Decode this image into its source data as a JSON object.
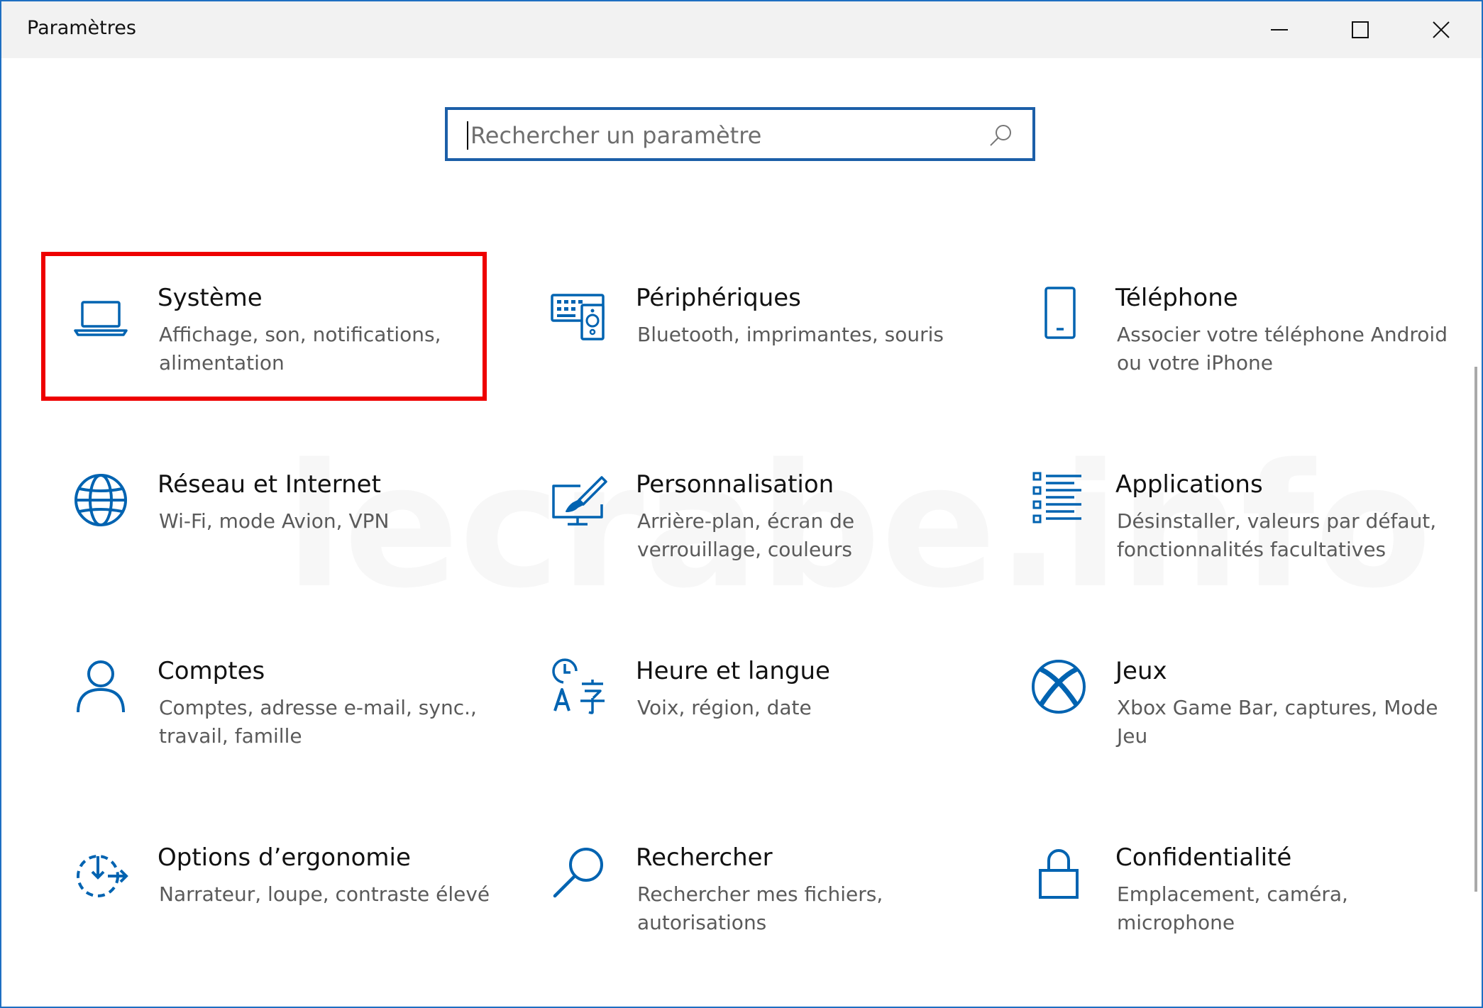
{
  "window": {
    "title": "Paramètres",
    "accent_color": "#0063b1",
    "controls": {
      "minimize_icon": "minimize-icon",
      "maximize_icon": "maximize-icon",
      "close_icon": "close-icon"
    }
  },
  "search": {
    "placeholder": "Rechercher un paramètre",
    "value": "",
    "icon": "search-icon"
  },
  "watermark": "lecrabe.info",
  "categories": [
    {
      "id": "systeme",
      "title": "Système",
      "subtitle": "Affichage, son, notifications, alimentation",
      "icon": "laptop-icon",
      "highlighted": true,
      "highlight_color": "#ee0000"
    },
    {
      "id": "peripheriques",
      "title": "Périphériques",
      "subtitle": "Bluetooth, imprimantes, souris",
      "icon": "devices-icon"
    },
    {
      "id": "telephone",
      "title": "Téléphone",
      "subtitle": "Associer votre téléphone Android ou votre iPhone",
      "icon": "phone-icon"
    },
    {
      "id": "reseau",
      "title": "Réseau et Internet",
      "subtitle": "Wi-Fi, mode Avion, VPN",
      "icon": "globe-icon"
    },
    {
      "id": "personnalisation",
      "title": "Personnalisation",
      "subtitle": "Arrière-plan, écran de verrouillage, couleurs",
      "icon": "paint-monitor-icon"
    },
    {
      "id": "applications",
      "title": "Applications",
      "subtitle": "Désinstaller, valeurs par défaut, fonctionnalités facultatives",
      "icon": "apps-list-icon"
    },
    {
      "id": "comptes",
      "title": "Comptes",
      "subtitle": "Comptes, adresse e-mail, sync., travail, famille",
      "icon": "person-icon"
    },
    {
      "id": "heure",
      "title": "Heure et langue",
      "subtitle": "Voix, région, date",
      "icon": "time-language-icon"
    },
    {
      "id": "jeux",
      "title": "Jeux",
      "subtitle": "Xbox Game Bar, captures, Mode Jeu",
      "icon": "xbox-icon"
    },
    {
      "id": "ergonomie",
      "title": "Options d’ergonomie",
      "subtitle": "Narrateur, loupe, contraste élevé",
      "icon": "ease-of-access-icon"
    },
    {
      "id": "rechercher",
      "title": "Rechercher",
      "subtitle": "Rechercher mes fichiers, autorisations",
      "icon": "magnifier-icon"
    },
    {
      "id": "confidentialite",
      "title": "Confidentialité",
      "subtitle": "Emplacement, caméra, microphone",
      "icon": "lock-icon"
    }
  ]
}
